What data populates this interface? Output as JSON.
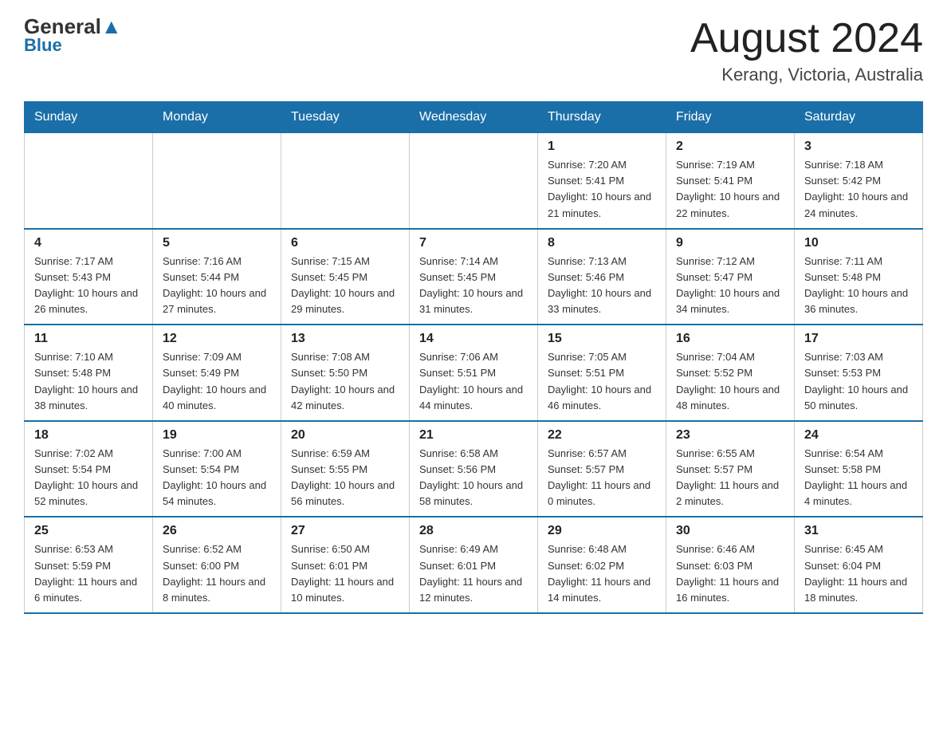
{
  "header": {
    "logo_general": "General",
    "logo_blue": "Blue",
    "month_title": "August 2024",
    "location": "Kerang, Victoria, Australia"
  },
  "days_of_week": [
    "Sunday",
    "Monday",
    "Tuesday",
    "Wednesday",
    "Thursday",
    "Friday",
    "Saturday"
  ],
  "weeks": [
    [
      {
        "day": "",
        "info": ""
      },
      {
        "day": "",
        "info": ""
      },
      {
        "day": "",
        "info": ""
      },
      {
        "day": "",
        "info": ""
      },
      {
        "day": "1",
        "info": "Sunrise: 7:20 AM\nSunset: 5:41 PM\nDaylight: 10 hours and 21 minutes."
      },
      {
        "day": "2",
        "info": "Sunrise: 7:19 AM\nSunset: 5:41 PM\nDaylight: 10 hours and 22 minutes."
      },
      {
        "day": "3",
        "info": "Sunrise: 7:18 AM\nSunset: 5:42 PM\nDaylight: 10 hours and 24 minutes."
      }
    ],
    [
      {
        "day": "4",
        "info": "Sunrise: 7:17 AM\nSunset: 5:43 PM\nDaylight: 10 hours and 26 minutes."
      },
      {
        "day": "5",
        "info": "Sunrise: 7:16 AM\nSunset: 5:44 PM\nDaylight: 10 hours and 27 minutes."
      },
      {
        "day": "6",
        "info": "Sunrise: 7:15 AM\nSunset: 5:45 PM\nDaylight: 10 hours and 29 minutes."
      },
      {
        "day": "7",
        "info": "Sunrise: 7:14 AM\nSunset: 5:45 PM\nDaylight: 10 hours and 31 minutes."
      },
      {
        "day": "8",
        "info": "Sunrise: 7:13 AM\nSunset: 5:46 PM\nDaylight: 10 hours and 33 minutes."
      },
      {
        "day": "9",
        "info": "Sunrise: 7:12 AM\nSunset: 5:47 PM\nDaylight: 10 hours and 34 minutes."
      },
      {
        "day": "10",
        "info": "Sunrise: 7:11 AM\nSunset: 5:48 PM\nDaylight: 10 hours and 36 minutes."
      }
    ],
    [
      {
        "day": "11",
        "info": "Sunrise: 7:10 AM\nSunset: 5:48 PM\nDaylight: 10 hours and 38 minutes."
      },
      {
        "day": "12",
        "info": "Sunrise: 7:09 AM\nSunset: 5:49 PM\nDaylight: 10 hours and 40 minutes."
      },
      {
        "day": "13",
        "info": "Sunrise: 7:08 AM\nSunset: 5:50 PM\nDaylight: 10 hours and 42 minutes."
      },
      {
        "day": "14",
        "info": "Sunrise: 7:06 AM\nSunset: 5:51 PM\nDaylight: 10 hours and 44 minutes."
      },
      {
        "day": "15",
        "info": "Sunrise: 7:05 AM\nSunset: 5:51 PM\nDaylight: 10 hours and 46 minutes."
      },
      {
        "day": "16",
        "info": "Sunrise: 7:04 AM\nSunset: 5:52 PM\nDaylight: 10 hours and 48 minutes."
      },
      {
        "day": "17",
        "info": "Sunrise: 7:03 AM\nSunset: 5:53 PM\nDaylight: 10 hours and 50 minutes."
      }
    ],
    [
      {
        "day": "18",
        "info": "Sunrise: 7:02 AM\nSunset: 5:54 PM\nDaylight: 10 hours and 52 minutes."
      },
      {
        "day": "19",
        "info": "Sunrise: 7:00 AM\nSunset: 5:54 PM\nDaylight: 10 hours and 54 minutes."
      },
      {
        "day": "20",
        "info": "Sunrise: 6:59 AM\nSunset: 5:55 PM\nDaylight: 10 hours and 56 minutes."
      },
      {
        "day": "21",
        "info": "Sunrise: 6:58 AM\nSunset: 5:56 PM\nDaylight: 10 hours and 58 minutes."
      },
      {
        "day": "22",
        "info": "Sunrise: 6:57 AM\nSunset: 5:57 PM\nDaylight: 11 hours and 0 minutes."
      },
      {
        "day": "23",
        "info": "Sunrise: 6:55 AM\nSunset: 5:57 PM\nDaylight: 11 hours and 2 minutes."
      },
      {
        "day": "24",
        "info": "Sunrise: 6:54 AM\nSunset: 5:58 PM\nDaylight: 11 hours and 4 minutes."
      }
    ],
    [
      {
        "day": "25",
        "info": "Sunrise: 6:53 AM\nSunset: 5:59 PM\nDaylight: 11 hours and 6 minutes."
      },
      {
        "day": "26",
        "info": "Sunrise: 6:52 AM\nSunset: 6:00 PM\nDaylight: 11 hours and 8 minutes."
      },
      {
        "day": "27",
        "info": "Sunrise: 6:50 AM\nSunset: 6:01 PM\nDaylight: 11 hours and 10 minutes."
      },
      {
        "day": "28",
        "info": "Sunrise: 6:49 AM\nSunset: 6:01 PM\nDaylight: 11 hours and 12 minutes."
      },
      {
        "day": "29",
        "info": "Sunrise: 6:48 AM\nSunset: 6:02 PM\nDaylight: 11 hours and 14 minutes."
      },
      {
        "day": "30",
        "info": "Sunrise: 6:46 AM\nSunset: 6:03 PM\nDaylight: 11 hours and 16 minutes."
      },
      {
        "day": "31",
        "info": "Sunrise: 6:45 AM\nSunset: 6:04 PM\nDaylight: 11 hours and 18 minutes."
      }
    ]
  ]
}
